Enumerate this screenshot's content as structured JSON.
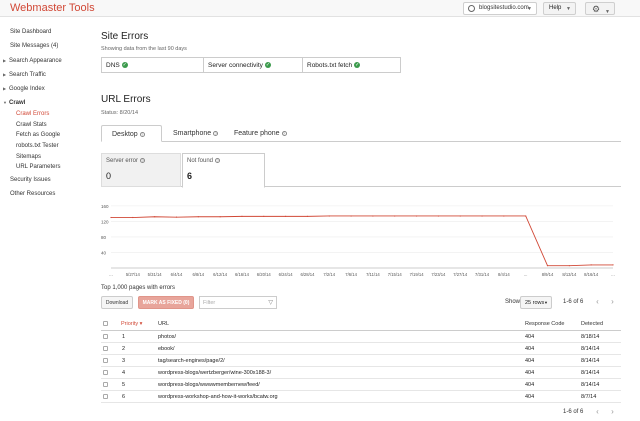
{
  "app": {
    "title": "Webmaster Tools",
    "site": "blogsitestudio.com",
    "help": "Help",
    "brand_color": "#d14836"
  },
  "sidebar": {
    "items": [
      {
        "label": "Site Dashboard"
      },
      {
        "label": "Site Messages (4)"
      },
      {
        "label": "Search Appearance"
      },
      {
        "label": "Search Traffic"
      },
      {
        "label": "Google Index"
      },
      {
        "label": "Crawl"
      },
      {
        "label": "Crawl Errors"
      },
      {
        "label": "Crawl Stats"
      },
      {
        "label": "Fetch as Google"
      },
      {
        "label": "robots.txt Tester"
      },
      {
        "label": "Sitemaps"
      },
      {
        "label": "URL Parameters"
      },
      {
        "label": "Security Issues"
      },
      {
        "label": "Other Resources"
      }
    ]
  },
  "site_errors": {
    "title": "Site Errors",
    "note": "Showing data from the last 90 days",
    "items": [
      {
        "label": "DNS"
      },
      {
        "label": "Server connectivity"
      },
      {
        "label": "Robots.txt fetch"
      }
    ]
  },
  "url_errors": {
    "title": "URL Errors",
    "status": "Status: 8/20/14",
    "tabs": [
      {
        "label": "Desktop"
      },
      {
        "label": "Smartphone"
      },
      {
        "label": "Feature phone"
      }
    ],
    "counters": [
      {
        "label": "Server error",
        "value": "0"
      },
      {
        "label": "Not found",
        "value": "6"
      }
    ]
  },
  "chart_data": {
    "type": "line",
    "x": [
      "...",
      "5/27/14",
      "5/31/14",
      "6/4/14",
      "6/8/14",
      "6/12/14",
      "6/16/14",
      "6/20/14",
      "6/24/14",
      "6/28/14",
      "7/2/14",
      "7/6/14",
      "7/11/14",
      "7/15/14",
      "7/19/14",
      "7/23/14",
      "7/27/14",
      "7/31/14",
      "8/4/14",
      "...",
      "8/9/14",
      "8/13/14",
      "8/16/14",
      "..."
    ],
    "y_ticks": [
      "160",
      "120",
      "80",
      "40"
    ],
    "ylim": [
      0,
      170
    ],
    "series": [
      {
        "color": "#d14836",
        "values": [
          130,
          130,
          132,
          131,
          132,
          132,
          133,
          133,
          133,
          133,
          134,
          134,
          134,
          134,
          134,
          134,
          134,
          134,
          134,
          134,
          6,
          6,
          8,
          8
        ]
      }
    ]
  },
  "table": {
    "top_label": "Top 1,000 pages with errors",
    "download": "Download",
    "mark_fixed": "MARK AS FIXED (0)",
    "filter_placeholder": "Filter",
    "show_label": "Show",
    "rows_option": "25 rows",
    "pager": "1-6 of 6",
    "headers": {
      "priority": "Priority",
      "url": "URL",
      "code": "Response Code",
      "detected": "Detected"
    },
    "rows": [
      {
        "priority": "1",
        "url": "photos/",
        "code": "404",
        "detected": "8/18/14"
      },
      {
        "priority": "2",
        "url": "ebook/",
        "code": "404",
        "detected": "8/14/14"
      },
      {
        "priority": "3",
        "url": "tag/search-engines/page/2/",
        "code": "404",
        "detected": "8/14/14"
      },
      {
        "priority": "4",
        "url": "wordpress-blogs/wertzberger/wine-300x188-3/",
        "code": "404",
        "detected": "8/14/14"
      },
      {
        "priority": "5",
        "url": "wordpress-blogs/wwwwmembernew/feed/",
        "code": "404",
        "detected": "8/14/14"
      },
      {
        "priority": "6",
        "url": "wordpress-workshop-and-how-it-works/bcatw.org",
        "code": "404",
        "detected": "8/7/14"
      }
    ]
  }
}
